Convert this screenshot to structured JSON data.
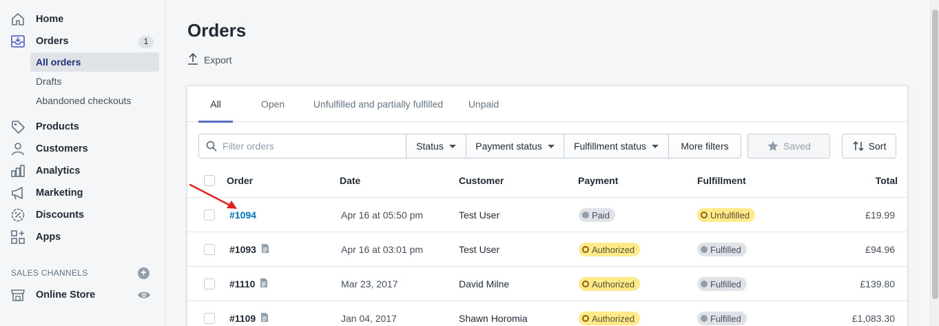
{
  "sidebar": {
    "home": "Home",
    "orders": "Orders",
    "orders_count": "1",
    "all_orders": "All orders",
    "drafts": "Drafts",
    "abandoned": "Abandoned checkouts",
    "products": "Products",
    "customers": "Customers",
    "analytics": "Analytics",
    "marketing": "Marketing",
    "discounts": "Discounts",
    "apps": "Apps",
    "sales_channels": "SALES CHANNELS",
    "online_store": "Online Store"
  },
  "page": {
    "title": "Orders",
    "export": "Export"
  },
  "tabs": [
    "All",
    "Open",
    "Unfulfilled and partially fulfilled",
    "Unpaid"
  ],
  "filters": {
    "search_placeholder": "Filter orders",
    "status": "Status",
    "payment_status": "Payment status",
    "fulfillment_status": "Fulfillment status",
    "more_filters": "More filters",
    "saved": "Saved",
    "sort": "Sort"
  },
  "columns": {
    "order": "Order",
    "date": "Date",
    "customer": "Customer",
    "payment": "Payment",
    "fulfillment": "Fulfillment",
    "total": "Total"
  },
  "orders": [
    {
      "number": "#1094",
      "date": "Apr 16 at 05:50 pm",
      "customer": "Test User",
      "payment": "Paid",
      "fulfillment": "Unfulfilled",
      "total": "£19.99"
    },
    {
      "number": "#1093",
      "date": "Apr 16 at 03:01 pm",
      "customer": "Test User",
      "payment": "Authorized",
      "fulfillment": "Fulfilled",
      "total": "£94.96"
    },
    {
      "number": "#1110",
      "date": "Mar 23, 2017",
      "customer": "David Milne",
      "payment": "Authorized",
      "fulfillment": "Fulfilled",
      "total": "£139.80"
    },
    {
      "number": "#1109",
      "date": "Jan 04, 2017",
      "customer": "Shawn Horomia",
      "payment": "Authorized",
      "fulfillment": "Fulfilled",
      "total": "£1,083.30"
    }
  ],
  "colors": {
    "accent": "#5c6ac4",
    "link": "#006fbb",
    "annotation_arrow": "#e0201f"
  }
}
